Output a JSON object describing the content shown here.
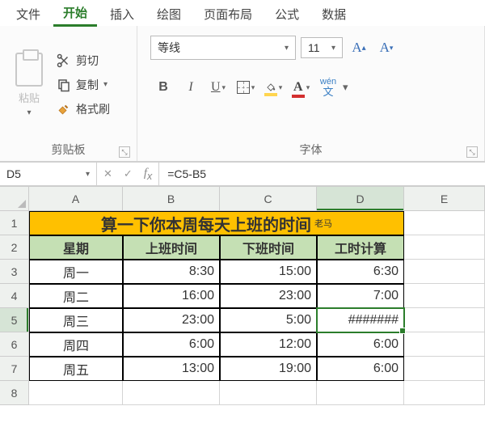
{
  "tabs": [
    "文件",
    "开始",
    "插入",
    "绘图",
    "页面布局",
    "公式",
    "数据"
  ],
  "active_tab": 1,
  "ribbon": {
    "clipboard": {
      "paste": "粘贴",
      "cut": "剪切",
      "copy": "复制",
      "format_painter": "格式刷",
      "group_label": "剪贴板"
    },
    "font": {
      "name": "等线",
      "size": "11",
      "group_label": "字体",
      "wen_top": "wén",
      "wen_bottom": "文"
    }
  },
  "namebox": "D5",
  "formula": "=C5-B5",
  "cols": [
    "A",
    "B",
    "C",
    "D",
    "E"
  ],
  "rows": [
    "1",
    "2",
    "3",
    "4",
    "5",
    "6",
    "7",
    "8"
  ],
  "selected_col": 3,
  "selected_row": 4,
  "sheet": {
    "title": "算一下你本周每天上班的时间",
    "title_suffix": "老马",
    "headers": [
      "星期",
      "上班时间",
      "下班时间",
      "工时计算"
    ],
    "rows": [
      [
        "周一",
        "8:30",
        "15:00",
        "6:30"
      ],
      [
        "周二",
        "16:00",
        "23:00",
        "7:00"
      ],
      [
        "周三",
        "23:00",
        "5:00",
        "#######"
      ],
      [
        "周四",
        "6:00",
        "12:00",
        "6:00"
      ],
      [
        "周五",
        "13:00",
        "19:00",
        "6:00"
      ]
    ]
  }
}
